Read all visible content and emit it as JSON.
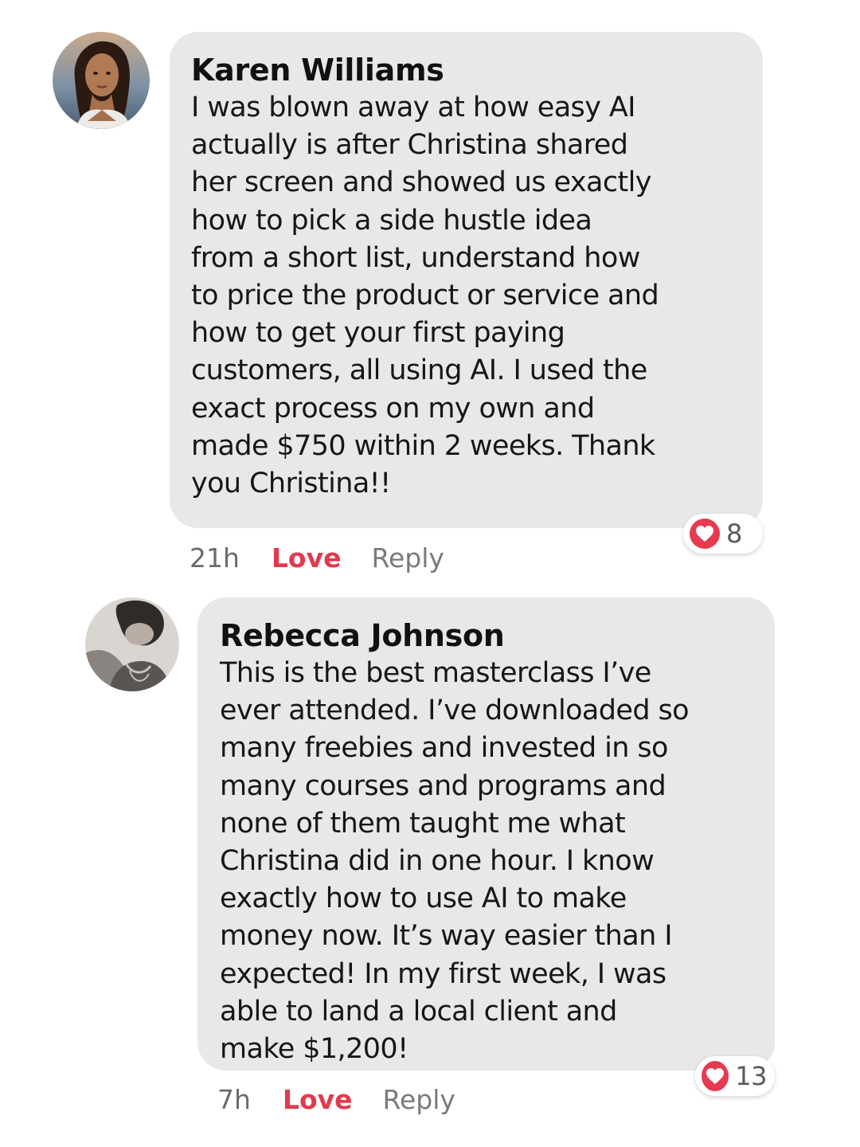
{
  "comments": [
    {
      "author": "Karen Williams",
      "text": "I was blown away at how easy AI\nactually is after Christina shared\nher screen and showed us exactly\nhow to pick a side hustle idea\nfrom a short list, understand how\nto price the product or service and\nhow to get your first paying\ncustomers, all using AI. I used the\nexact process on my own and\nmade $750 within 2 weeks. Thank\nyou Christina!!",
      "time": "21h",
      "love_label": "Love",
      "reply_label": "Reply",
      "reaction_count": "8",
      "reaction_icon": "heart-icon"
    },
    {
      "author": "Rebecca Johnson",
      "text": "This is the best masterclass I’ve\never attended. I’ve downloaded so\nmany freebies and invested in so\nmany courses and programs and\nnone of them taught me what\nChristina did in one hour. I know\nexactly how to use AI to make\nmoney now. It’s way easier than I\nexpected! In my first week, I was\nable to land a local client and\nmake $1,200!",
      "time": "7h",
      "love_label": "Love",
      "reply_label": "Reply",
      "reaction_count": "13",
      "reaction_icon": "heart-icon"
    }
  ],
  "colors": {
    "bubble": "#e8e8e8",
    "love": "#e23a4d",
    "heart": "#e63a4f"
  }
}
